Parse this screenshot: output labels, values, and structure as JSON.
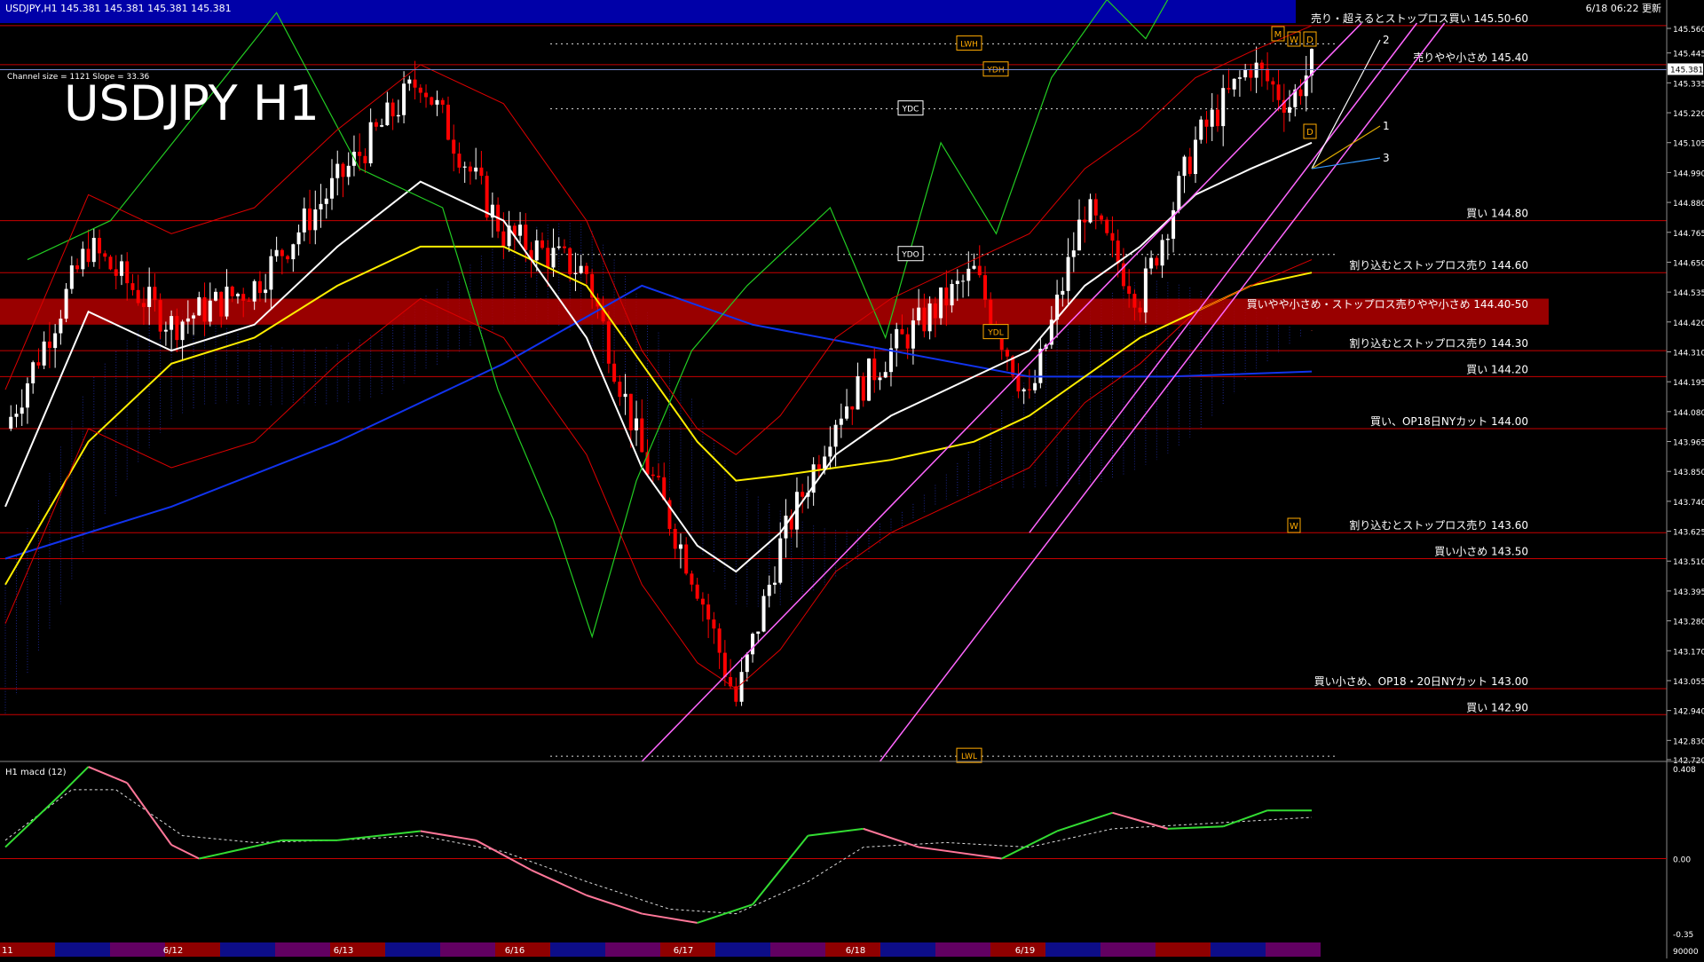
{
  "window": {
    "info": "USDJPY,H1  145.381 145.381 145.381 145.381",
    "updated": "6/18 06:22 更新",
    "big_title": "USDJPY H1",
    "channel_info": "Channel size = 1121 Slope = 33.36",
    "macd_label": "H1  macd (12)"
  },
  "colors": {
    "background": "#000000",
    "header_band": "#0000a8",
    "bull_candle": "#ffffff",
    "bear_candle": "#ff0000",
    "level_line": "#c80000",
    "zone_band": "#b40000",
    "channel": "#ff66ff",
    "macd_line": "#33dd33",
    "macd_neg": "#ff7799",
    "signal_line": "#dddddd",
    "sma_short": "#ffffff",
    "sma_mid": "#ffee00",
    "sma_long": "#1133ee"
  },
  "chart_data": {
    "type": "candlestick",
    "symbol": "USDJPY",
    "timeframe": "H1",
    "ylim": [
      142.72,
      145.56
    ],
    "current_price": "145.381",
    "price_axis_ticks": [
      "145.560",
      "145.445",
      "145.335",
      "145.220",
      "145.105",
      "144.990",
      "144.880",
      "144.765",
      "144.650",
      "144.535",
      "144.420",
      "144.310",
      "144.195",
      "144.080",
      "143.965",
      "143.850",
      "143.740",
      "143.625",
      "143.510",
      "143.395",
      "143.280",
      "143.170",
      "143.055",
      "142.940",
      "142.830",
      "142.720"
    ],
    "date_labels": [
      "6/12",
      "6/13",
      "6/16",
      "6/17",
      "6/18",
      "6/19"
    ],
    "levels": [
      {
        "price": 145.55,
        "text": "売り・超えるとストップロス買い 145.50-60"
      },
      {
        "price": 145.4,
        "text": "売りやや小さめ 145.40"
      },
      {
        "price": 144.8,
        "text": "買い 144.80"
      },
      {
        "price": 144.6,
        "text": "割り込むとストップロス売り 144.60"
      },
      {
        "price": 144.45,
        "text": "買いやや小さめ・ストップロス売りやや小さめ 144.40-50",
        "zone": [
          144.4,
          144.5
        ]
      },
      {
        "price": 144.3,
        "text": "割り込むとストップロス売り 144.30"
      },
      {
        "price": 144.2,
        "text": "買い 144.20"
      },
      {
        "price": 144.0,
        "text": "買い、OP18日NYカット 144.00"
      },
      {
        "price": 143.6,
        "text": "割り込むとストップロス売り 143.60"
      },
      {
        "price": 143.5,
        "text": "買い小さめ 143.50"
      },
      {
        "price": 143.0,
        "text": "買い小さめ、OP18・20日NYカット 143.00"
      },
      {
        "price": 142.9,
        "text": "買い 142.90"
      }
    ],
    "tags": [
      {
        "label": "LWH",
        "price": 145.48
      },
      {
        "label": "YDH",
        "price": 145.38
      },
      {
        "label": "YDC",
        "price": 145.23
      },
      {
        "label": "YDO",
        "price": 144.67
      },
      {
        "label": "YDL",
        "price": 144.37
      },
      {
        "label": "LWL",
        "price": 142.74
      }
    ],
    "projection_labels": [
      "2",
      "1",
      "3"
    ],
    "pattern_markers": [
      "M",
      "W",
      "D",
      "D",
      "W"
    ],
    "macd_ticks": [
      "0.408",
      "0.00",
      "-0.35"
    ],
    "macd_ylim": [
      -0.35,
      0.408
    ],
    "volume_tick": "90000",
    "start_label": "11",
    "anchors": [
      [
        0,
        144.0
      ],
      [
        15,
        144.7
      ],
      [
        30,
        144.4
      ],
      [
        45,
        144.55
      ],
      [
        60,
        144.95
      ],
      [
        75,
        145.35
      ],
      [
        90,
        144.75
      ],
      [
        105,
        144.6
      ],
      [
        115,
        143.9
      ],
      [
        125,
        143.4
      ],
      [
        132,
        142.95
      ],
      [
        140,
        143.55
      ],
      [
        150,
        144.05
      ],
      [
        160,
        144.3
      ],
      [
        175,
        144.6
      ],
      [
        185,
        144.1
      ],
      [
        195,
        144.85
      ],
      [
        205,
        144.5
      ],
      [
        215,
        145.1
      ],
      [
        225,
        145.4
      ],
      [
        232,
        145.25
      ],
      [
        236,
        145.4
      ]
    ],
    "sma_short": [
      [
        0,
        143.7
      ],
      [
        15,
        144.45
      ],
      [
        30,
        144.3
      ],
      [
        45,
        144.4
      ],
      [
        60,
        144.7
      ],
      [
        75,
        144.95
      ],
      [
        90,
        144.8
      ],
      [
        105,
        144.35
      ],
      [
        115,
        143.85
      ],
      [
        125,
        143.55
      ],
      [
        132,
        143.45
      ],
      [
        140,
        143.6
      ],
      [
        150,
        143.9
      ],
      [
        160,
        144.05
      ],
      [
        175,
        144.2
      ],
      [
        185,
        144.3
      ],
      [
        195,
        144.55
      ],
      [
        205,
        144.7
      ],
      [
        215,
        144.9
      ],
      [
        225,
        145.0
      ],
      [
        236,
        145.1
      ]
    ],
    "sma_mid": [
      [
        0,
        143.4
      ],
      [
        15,
        143.95
      ],
      [
        30,
        144.25
      ],
      [
        45,
        144.35
      ],
      [
        60,
        144.55
      ],
      [
        75,
        144.7
      ],
      [
        90,
        144.7
      ],
      [
        105,
        144.55
      ],
      [
        115,
        144.25
      ],
      [
        125,
        143.95
      ],
      [
        132,
        143.8
      ],
      [
        140,
        143.82
      ],
      [
        150,
        143.85
      ],
      [
        160,
        143.88
      ],
      [
        175,
        143.95
      ],
      [
        185,
        144.05
      ],
      [
        195,
        144.2
      ],
      [
        205,
        144.35
      ],
      [
        215,
        144.45
      ],
      [
        225,
        144.55
      ],
      [
        236,
        144.6
      ]
    ],
    "sma_long": [
      [
        0,
        143.5
      ],
      [
        30,
        143.7
      ],
      [
        60,
        143.95
      ],
      [
        90,
        144.25
      ],
      [
        115,
        144.55
      ],
      [
        135,
        144.4
      ],
      [
        160,
        144.3
      ],
      [
        185,
        144.2
      ],
      [
        210,
        144.2
      ],
      [
        236,
        144.22
      ]
    ],
    "channels": [
      [
        [
          115,
          142.72
        ],
        [
          245,
          145.56
        ]
      ],
      [
        [
          158,
          142.72
        ],
        [
          260,
          145.56
        ]
      ],
      [
        [
          185,
          143.6
        ],
        [
          255,
          145.56
        ]
      ]
    ],
    "macd": [
      [
        0,
        0.05
      ],
      [
        10,
        0.28
      ],
      [
        15,
        0.4
      ],
      [
        22,
        0.33
      ],
      [
        30,
        0.06
      ],
      [
        35,
        0.0
      ],
      [
        50,
        0.08
      ],
      [
        60,
        0.08
      ],
      [
        75,
        0.12
      ],
      [
        85,
        0.08
      ],
      [
        95,
        -0.05
      ],
      [
        105,
        -0.16
      ],
      [
        115,
        -0.24
      ],
      [
        125,
        -0.28
      ],
      [
        135,
        -0.2
      ],
      [
        145,
        0.1
      ],
      [
        155,
        0.13
      ],
      [
        165,
        0.05
      ],
      [
        180,
        0.0
      ],
      [
        190,
        0.12
      ],
      [
        200,
        0.2
      ],
      [
        210,
        0.13
      ],
      [
        220,
        0.14
      ],
      [
        228,
        0.21
      ],
      [
        236,
        0.21
      ]
    ],
    "signal": [
      [
        0,
        0.08
      ],
      [
        12,
        0.3
      ],
      [
        20,
        0.3
      ],
      [
        32,
        0.1
      ],
      [
        45,
        0.07
      ],
      [
        60,
        0.08
      ],
      [
        75,
        0.1
      ],
      [
        90,
        0.03
      ],
      [
        105,
        -0.1
      ],
      [
        120,
        -0.22
      ],
      [
        132,
        -0.24
      ],
      [
        145,
        -0.1
      ],
      [
        155,
        0.05
      ],
      [
        170,
        0.07
      ],
      [
        185,
        0.05
      ],
      [
        200,
        0.13
      ],
      [
        215,
        0.15
      ],
      [
        236,
        0.18
      ]
    ]
  }
}
